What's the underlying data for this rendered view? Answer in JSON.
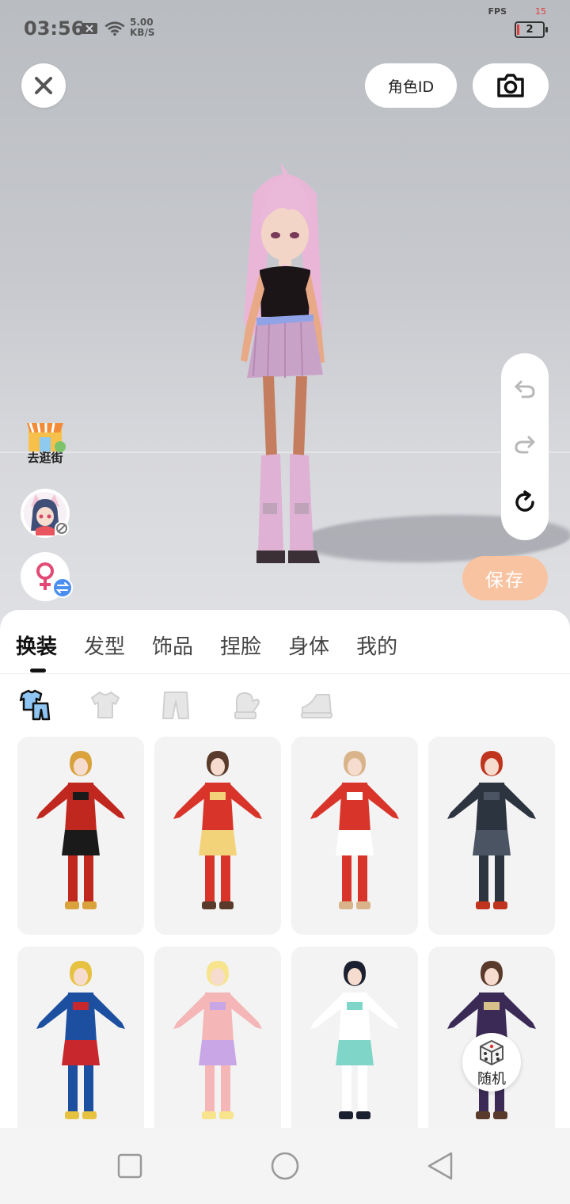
{
  "status_bar": {
    "time": "03:56",
    "speed_value": "5.00",
    "speed_unit": "KB/S",
    "fps_label": "FPS",
    "fps_value": "15",
    "battery": "2"
  },
  "top_bar": {
    "role_id_label": "角色ID"
  },
  "left_actions": {
    "shop_label": "去逛街"
  },
  "save_label": "保存",
  "tabs": [
    {
      "label": "换装",
      "active": true
    },
    {
      "label": "发型",
      "active": false
    },
    {
      "label": "饰品",
      "active": false
    },
    {
      "label": "捏脸",
      "active": false
    },
    {
      "label": "身体",
      "active": false
    },
    {
      "label": "我的",
      "active": false
    }
  ],
  "categories": [
    {
      "icon": "outfit-set-icon",
      "active": true
    },
    {
      "icon": "top-icon",
      "active": false
    },
    {
      "icon": "pants-icon",
      "active": false
    },
    {
      "icon": "glove-icon",
      "active": false
    },
    {
      "icon": "shoe-icon",
      "active": false
    }
  ],
  "outfits": [
    {
      "icon": "outfit-red-gown",
      "colors": [
        "#c0271e",
        "#1a1a1a",
        "#d9a23c"
      ]
    },
    {
      "icon": "outfit-red-dress",
      "colors": [
        "#d8342a",
        "#f3d37a",
        "#5a3a2a"
      ]
    },
    {
      "icon": "outfit-red-coat",
      "colors": [
        "#d8342a",
        "#ffffff",
        "#d9b48a"
      ]
    },
    {
      "icon": "outfit-black-suit",
      "colors": [
        "#2c3440",
        "#4a5462",
        "#c0341e"
      ]
    },
    {
      "icon": "outfit-hero-suit",
      "colors": [
        "#1d4fa0",
        "#c9272e",
        "#e6c240"
      ]
    },
    {
      "icon": "outfit-cat-costume",
      "colors": [
        "#f4b6b6",
        "#c9a6e6",
        "#f7e48c"
      ]
    },
    {
      "icon": "outfit-sport-tee",
      "colors": [
        "#ffffff",
        "#7fd6c8",
        "#1b2030"
      ]
    },
    {
      "icon": "outfit-school-coat",
      "colors": [
        "#3a2a55",
        "#d8c08a",
        "#5a3a2a"
      ]
    }
  ],
  "random_label": "随机"
}
